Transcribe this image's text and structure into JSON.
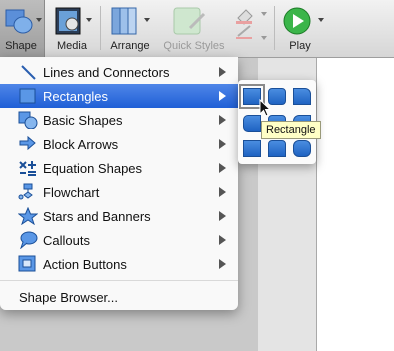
{
  "toolbar": {
    "shape_label": "Shape",
    "media_label": "Media",
    "arrange_label": "Arrange",
    "quick_styles_label": "Quick Styles",
    "play_label": "Play"
  },
  "menu": {
    "items": [
      {
        "label": "Lines and Connectors"
      },
      {
        "label": "Rectangles"
      },
      {
        "label": "Basic Shapes"
      },
      {
        "label": "Block Arrows"
      },
      {
        "label": "Equation Shapes"
      },
      {
        "label": "Flowchart"
      },
      {
        "label": "Stars and Banners"
      },
      {
        "label": "Callouts"
      },
      {
        "label": "Action Buttons"
      }
    ],
    "selected": "Rectangles",
    "browser_label": "Shape Browser..."
  },
  "submenu": {
    "tooltip": "Rectangle"
  },
  "colors": {
    "selection": "#2f6fe0",
    "shape_fill": "#2e73d2",
    "tooltip_bg": "#ffffc6",
    "play_green": "#2fa33a"
  }
}
